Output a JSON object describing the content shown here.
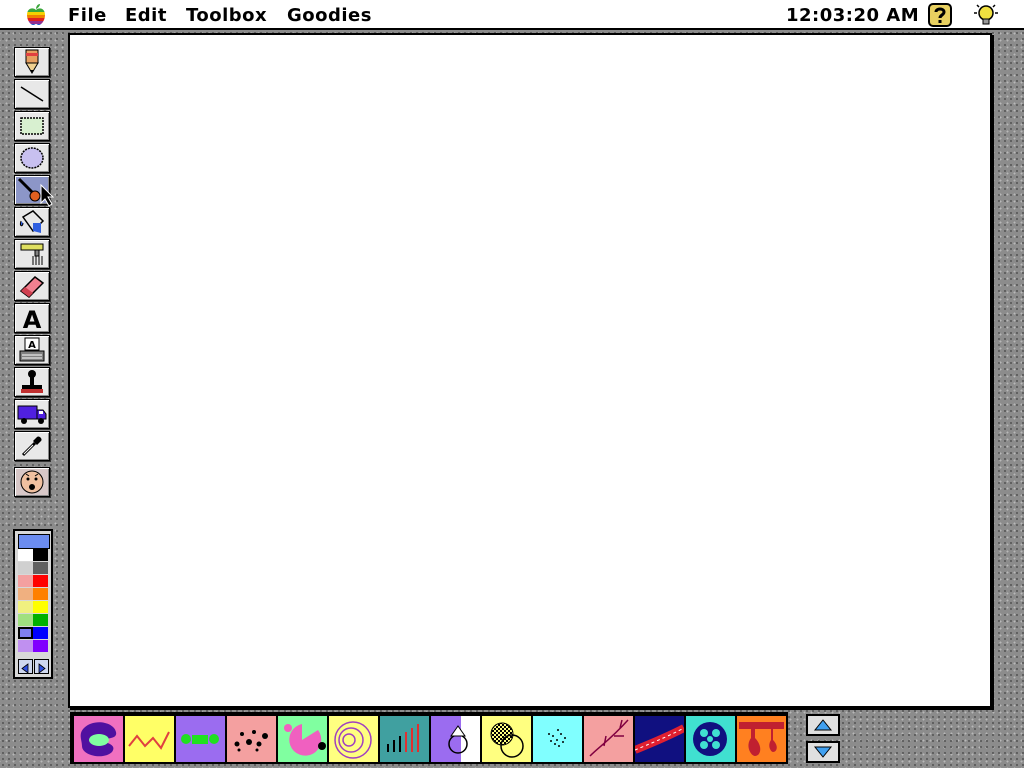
{
  "menubar": {
    "apple_icon": "apple-rainbow-icon",
    "menus": [
      {
        "label": "File"
      },
      {
        "label": "Edit"
      },
      {
        "label": "Toolbox"
      },
      {
        "label": "Goodies"
      }
    ],
    "clock": "12:03:20 AM",
    "help_icon": "question-mark-icon",
    "bulb_icon": "light-bulb-icon"
  },
  "toolbox": {
    "tools": [
      {
        "name": "pencil-tool",
        "icon": "pencil-icon"
      },
      {
        "name": "line-tool",
        "icon": "line-icon"
      },
      {
        "name": "rectangle-tool",
        "icon": "rectangle-icon"
      },
      {
        "name": "oval-tool",
        "icon": "oval-icon"
      },
      {
        "name": "wacky-brush-tool",
        "icon": "brush-icon",
        "selected": true
      },
      {
        "name": "paint-bucket-tool",
        "icon": "bucket-icon"
      },
      {
        "name": "wacky-mixer-tool",
        "icon": "mixer-icon"
      },
      {
        "name": "eraser-tool",
        "icon": "eraser-icon"
      },
      {
        "name": "text-tool",
        "icon": "letter-a-icon",
        "glyph": "A"
      },
      {
        "name": "alphabet-stamp-tool",
        "icon": "typewriter-a-icon",
        "glyph": "A"
      },
      {
        "name": "rubber-stamp-tool",
        "icon": "stamp-icon"
      },
      {
        "name": "moving-van-tool",
        "icon": "truck-icon"
      },
      {
        "name": "eyedropper-tool",
        "icon": "eyedropper-icon"
      },
      {
        "name": "undo-guy-tool",
        "icon": "face-icon"
      }
    ]
  },
  "palette": {
    "current_color": "#6b8cf0",
    "colors": [
      "#ffffff",
      "#000000",
      "#d0d0d0",
      "#606060",
      "#f4a0a0",
      "#ff0000",
      "#f0b080",
      "#ff8000",
      "#f0f080",
      "#ffff00",
      "#a0e080",
      "#00b000",
      "#8080f0",
      "#0000ff",
      "#c090f0",
      "#8000ff"
    ],
    "arrow_icons": [
      "palette-left-arrow-icon",
      "palette-right-arrow-icon"
    ]
  },
  "options_strip": {
    "items": [
      {
        "name": "option-blob-brush",
        "bg": "#f070c0",
        "selected": true
      },
      {
        "name": "option-zigzag-brush",
        "bg": "#ffff66"
      },
      {
        "name": "option-dotted-line-brush",
        "bg": "#9b6cf0"
      },
      {
        "name": "option-spots-brush",
        "bg": "#f4a0a0"
      },
      {
        "name": "option-pie-brush",
        "bg": "#80ffa0"
      },
      {
        "name": "option-circles-brush",
        "bg": "#ffff80"
      },
      {
        "name": "option-bars-brush",
        "bg": "#40a0a0"
      },
      {
        "name": "option-shapes-brush",
        "bg": "#9b6cf0"
      },
      {
        "name": "option-checker-brush",
        "bg": "#ffff80"
      },
      {
        "name": "option-spray-brush",
        "bg": "#80ffff"
      },
      {
        "name": "option-tree-brush",
        "bg": "#f4a0a0"
      },
      {
        "name": "option-road-brush",
        "bg": "#101080"
      },
      {
        "name": "option-circles-pattern-brush",
        "bg": "#40e0d0"
      },
      {
        "name": "option-drip-brush",
        "bg": "#ff8020"
      }
    ],
    "scroll_up_icon": "scroll-up-arrow-icon",
    "scroll_down_icon": "scroll-down-arrow-icon"
  }
}
